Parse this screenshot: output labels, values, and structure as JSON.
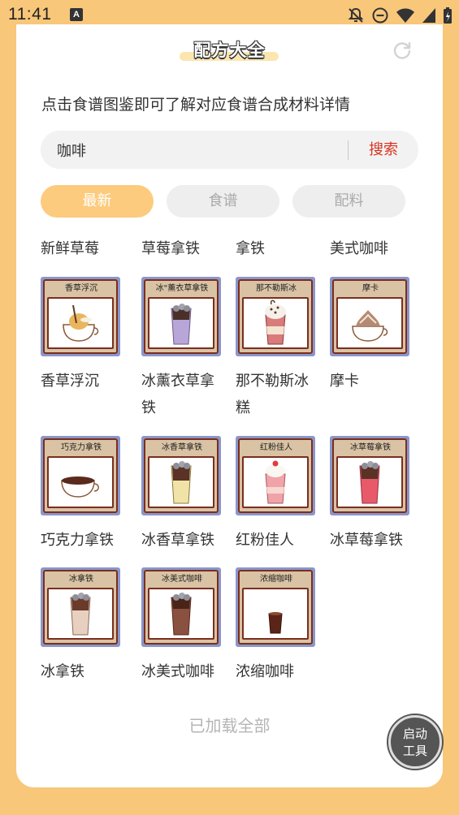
{
  "status_bar": {
    "time": "11:41"
  },
  "header": {
    "title": "配方大全"
  },
  "description": "点击食谱图鉴即可了解对应食谱合成材料详情",
  "search": {
    "value": "咖啡",
    "button_label": "搜索"
  },
  "tabs": [
    {
      "label": "最新",
      "active": true
    },
    {
      "label": "食谱",
      "active": false
    },
    {
      "label": "配料",
      "active": false
    }
  ],
  "top_row": [
    "新鲜草莓",
    "草莓拿铁",
    "拿铁",
    "美式咖啡"
  ],
  "recipes": [
    {
      "name": "香草浮沉",
      "card_label": "香草浮沉",
      "icon": "vanilla-float-icon"
    },
    {
      "name": "冰薰衣草拿铁",
      "card_label": "冰\"薰衣草拿铁",
      "icon": "iced-lavender-latte-icon"
    },
    {
      "name": "那不勒斯冰糕",
      "card_label": "那不勒斯冰",
      "icon": "neapolitan-sorbet-icon"
    },
    {
      "name": "摩卡",
      "card_label": "摩卡",
      "icon": "mocha-icon"
    },
    {
      "name": "巧克力拿铁",
      "card_label": "巧克力拿铁",
      "icon": "chocolate-latte-icon"
    },
    {
      "name": "冰香草拿铁",
      "card_label": "冰香草拿铁",
      "icon": "iced-vanilla-latte-icon"
    },
    {
      "name": "红粉佳人",
      "card_label": "红粉佳人",
      "icon": "pink-lady-icon"
    },
    {
      "name": "冰草莓拿铁",
      "card_label": "冰草莓拿铁",
      "icon": "iced-strawberry-latte-icon"
    },
    {
      "name": "冰拿铁",
      "card_label": "冰拿铁",
      "icon": "iced-latte-icon"
    },
    {
      "name": "冰美式咖啡",
      "card_label": "冰美式咖啡",
      "icon": "iced-americano-icon"
    },
    {
      "name": "浓缩咖啡",
      "card_label": "浓缩咖啡",
      "icon": "espresso-icon"
    }
  ],
  "footer": {
    "text": "已加载全部"
  },
  "floating_button": {
    "line1": "启动",
    "line2": "工具"
  },
  "colors": {
    "accent": "#fdcb7d",
    "background": "#f8c77a",
    "search_button": "#d9321f"
  }
}
